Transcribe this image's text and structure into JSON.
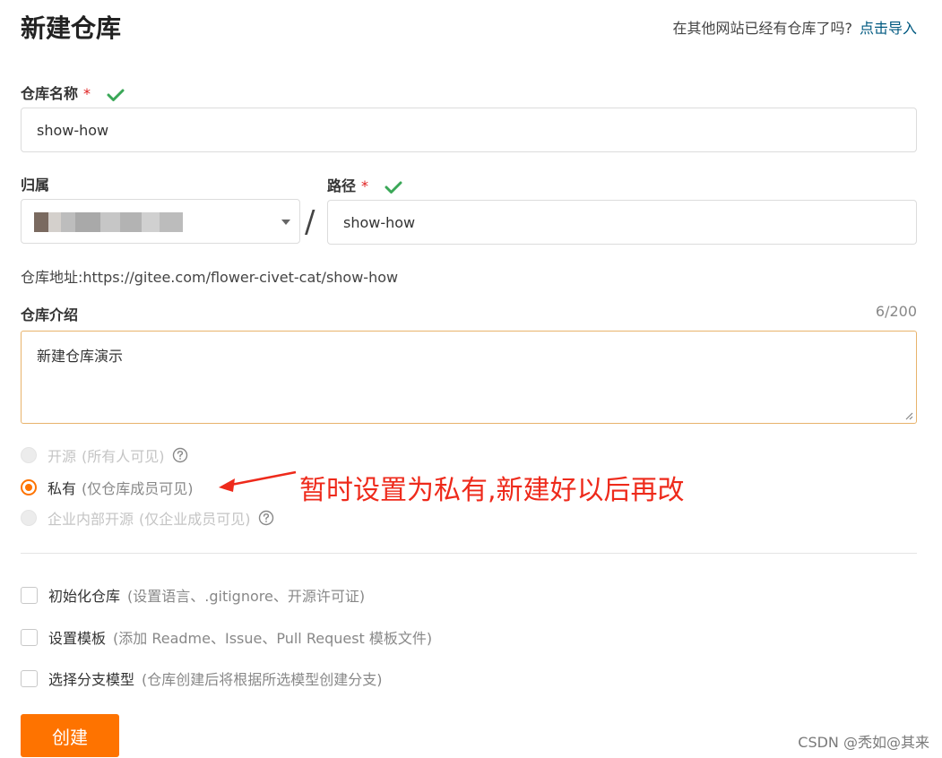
{
  "header": {
    "title": "新建仓库",
    "import_question": "在其他网站已经有仓库了吗?",
    "import_link": "点击导入"
  },
  "form": {
    "repo_name_label": "仓库名称",
    "required_mark": "*",
    "repo_name_value": "show-how",
    "owner_label": "归属",
    "path_label": "路径",
    "path_separator": "/",
    "path_value": "show-how",
    "address_text": "仓库地址:https://gitee.com/flower-civet-cat/show-how",
    "description_label": "仓库介绍",
    "description_counter": "6/200",
    "description_value": "新建仓库演示"
  },
  "visibility": {
    "options": [
      {
        "label": "开源",
        "hint": "(所有人可见)",
        "state": "disabled",
        "has_help": true
      },
      {
        "label": "私有",
        "hint": "(仅仓库成员可见)",
        "state": "selected",
        "has_help": false
      },
      {
        "label": "企业内部开源",
        "hint": "(仅企业成员可见)",
        "state": "disabled",
        "has_help": true
      }
    ]
  },
  "annotation": {
    "text": "暂时设置为私有,新建好以后再改",
    "color": "#ee2a1b"
  },
  "options": [
    {
      "label": "初始化仓库",
      "hint": "(设置语言、.gitignore、开源许可证)",
      "checked": false
    },
    {
      "label": "设置模板",
      "hint": "(添加 Readme、Issue、Pull Request 模板文件)",
      "checked": false
    },
    {
      "label": "选择分支模型",
      "hint": "(仓库创建后将根据所选模型创建分支)",
      "checked": false
    }
  ],
  "submit": {
    "label": "创建"
  },
  "watermark": "CSDN @秃如@其来",
  "colors": {
    "accent": "#fe7300",
    "link": "#005980",
    "valid_check": "#3aa757",
    "required": "#e02020"
  },
  "icons": {
    "valid": "check-icon",
    "help": "question-circle-icon",
    "dropdown": "caret-down-icon"
  }
}
